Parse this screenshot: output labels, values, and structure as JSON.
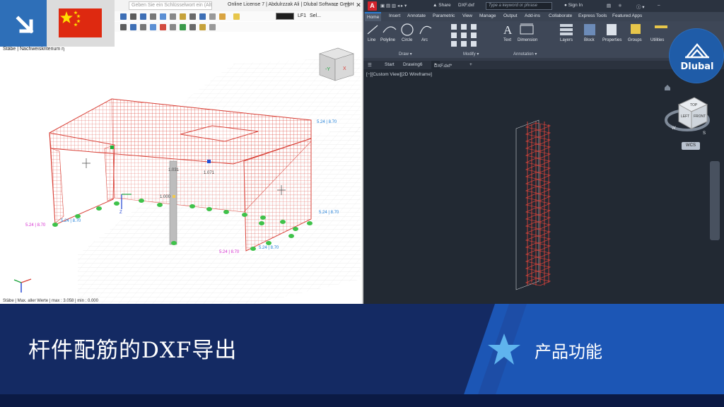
{
  "rfem": {
    "search_placeholder": "Geben Sie ein Schlüsselwort ein (Alt...",
    "license_text": "Online License 7 | Abdulrzzak Ali | Dlubal Software GmbH",
    "panel_label": "Stäbe | Nachweiskriterium η",
    "status_text": "Stäbe | Max. aller Werte | max : 3.058 | min : 0.000",
    "load_case": "LF1",
    "load_case_filter": "Sel...",
    "view_cube_axis_y": "-Y",
    "view_cube_axis_x": "X",
    "labels": [
      {
        "text": "5.24 | 8.70"
      },
      {
        "text": "5.24 | 8.70"
      },
      {
        "text": "5.24 | 8.70"
      },
      {
        "text": "5.24 | 8.70"
      },
      {
        "text": "5.24 | 8.70"
      },
      {
        "text": "5.24 | 8.70"
      }
    ],
    "value_labels": [
      "1.071",
      "1.000",
      "1.031"
    ]
  },
  "acad": {
    "share_label": "Share",
    "file_title": "DXF.dxf",
    "keyword_placeholder": "Type a keyword or phrase",
    "sign_in": "Sign In",
    "menus": [
      "Home",
      "Insert",
      "Annotate",
      "Parametric",
      "View",
      "Manage",
      "Output",
      "Add-ins",
      "Collaborate",
      "Express Tools",
      "Featured Apps"
    ],
    "ribbon_tools": [
      "Line",
      "Polyline",
      "Circle",
      "Arc",
      "Text",
      "Dimension",
      "Layers",
      "Block",
      "Properties",
      "Groups",
      "Utilities"
    ],
    "groups": [
      "Draw",
      "Modify",
      "Annotation"
    ],
    "tabs": [
      "Start",
      "Drawing6",
      "DXF.dxf*"
    ],
    "viewport_label": "[−][Custom View][2D Wireframe]",
    "wcs": "WCS",
    "viewcube": {
      "top": "TOP",
      "left": "LEFT",
      "front": "FRONT",
      "west": "W",
      "south": "S"
    }
  },
  "brand": {
    "name": "Dlubal"
  },
  "banner": {
    "title": "杆件配筋的DXF导出",
    "feature": "产品功能"
  },
  "colors": {
    "banner_bg": "#142a63",
    "banner_accent": "#1c56b5",
    "rebar": "#d9433a",
    "acad_bg": "#222933",
    "dlubal_blue": "#1f5ca8",
    "flag_red": "#de2910",
    "flag_star": "#ffde00"
  }
}
